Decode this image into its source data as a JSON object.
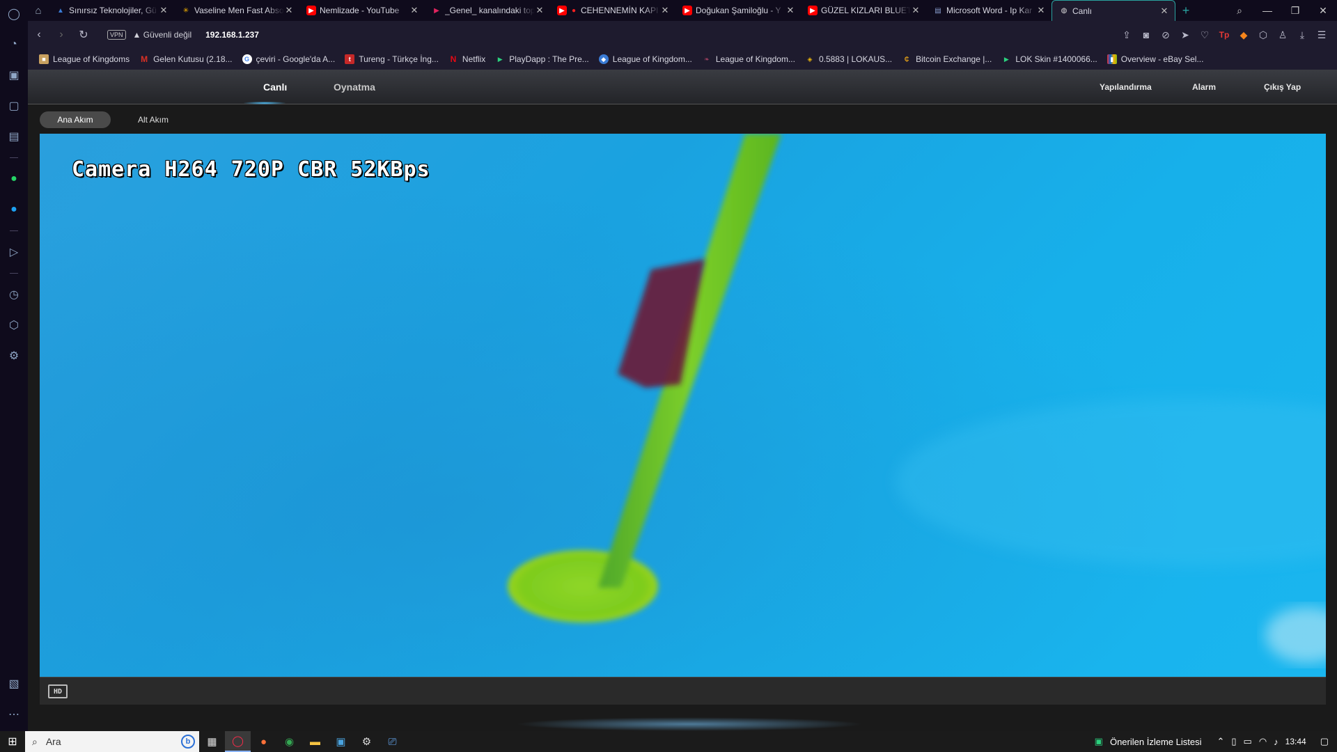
{
  "browser": {
    "tabs": [
      {
        "title": "Sınırsız Teknolojiler, Gü",
        "favicon": "blue-triangle",
        "color": "#3a7bd5"
      },
      {
        "title": "Vaseline Men Fast Abso",
        "favicon": "walmart-spark",
        "color": "#f5b400"
      },
      {
        "title": "Nemlizade - YouTube",
        "favicon": "youtube",
        "color": "#ff0000"
      },
      {
        "title": "_Genel_ kanalındaki top",
        "favicon": "red-play",
        "color": "#e0245e"
      },
      {
        "title": "CEHENNEMİN KAPI",
        "favicon": "youtube",
        "color": "#ff0000"
      },
      {
        "title": "Doğukan Şamiloğlu - Y",
        "favicon": "youtube",
        "color": "#ff0000"
      },
      {
        "title": "GÜZEL KIZLARI BLUETO",
        "favicon": "youtube",
        "color": "#ff0000"
      },
      {
        "title": "Microsoft Word - Ip Kar",
        "favicon": "doc",
        "color": "#5a6e9a"
      },
      {
        "title": "Canlı",
        "favicon": "globe",
        "color": "#cccccc",
        "active": true
      }
    ],
    "address": {
      "vpn_label": "VPN",
      "security_text": "Güvenli değil",
      "url": "192.168.1.237"
    },
    "bookmarks": [
      {
        "label": "League of Kingdoms",
        "color": "#c8a060"
      },
      {
        "label": "Gelen Kutusu (2.18...",
        "color": "#d93025"
      },
      {
        "label": "çeviri - Google'da A...",
        "color": "#4285f4"
      },
      {
        "label": "Tureng - Türkçe İng...",
        "color": "#c62828"
      },
      {
        "label": "Netflix",
        "color": "#e50914"
      },
      {
        "label": "PlayDapp : The Pre...",
        "color": "#2bd17e"
      },
      {
        "label": "League of Kingdom...",
        "color": "#3a7bd5"
      },
      {
        "label": "League of Kingdom...",
        "color": "#a04060"
      },
      {
        "label": "0.5883 | LOKAUS...",
        "color": "#f0b90b"
      },
      {
        "label": "Bitcoin Exchange |...",
        "color": "#e8a317"
      },
      {
        "label": "LOK Skin #1400066...",
        "color": "#2bd17e"
      },
      {
        "label": "Overview - eBay Sel...",
        "color": "#e53238"
      }
    ]
  },
  "camera_ui": {
    "nav": {
      "live": "Canlı",
      "playback": "Oynatma",
      "config": "Yapılandırma",
      "alarm": "Alarm",
      "logout": "Çıkış Yap"
    },
    "streams": {
      "main": "Ana Akım",
      "sub": "Alt Akım"
    },
    "osd_text": "Camera H264 720P CBR 52KBps",
    "hd_button": "HD"
  },
  "taskbar": {
    "search_placeholder": "Ara",
    "tray_watchlist": "Önerilen İzleme Listesi",
    "clock": "13:44"
  }
}
